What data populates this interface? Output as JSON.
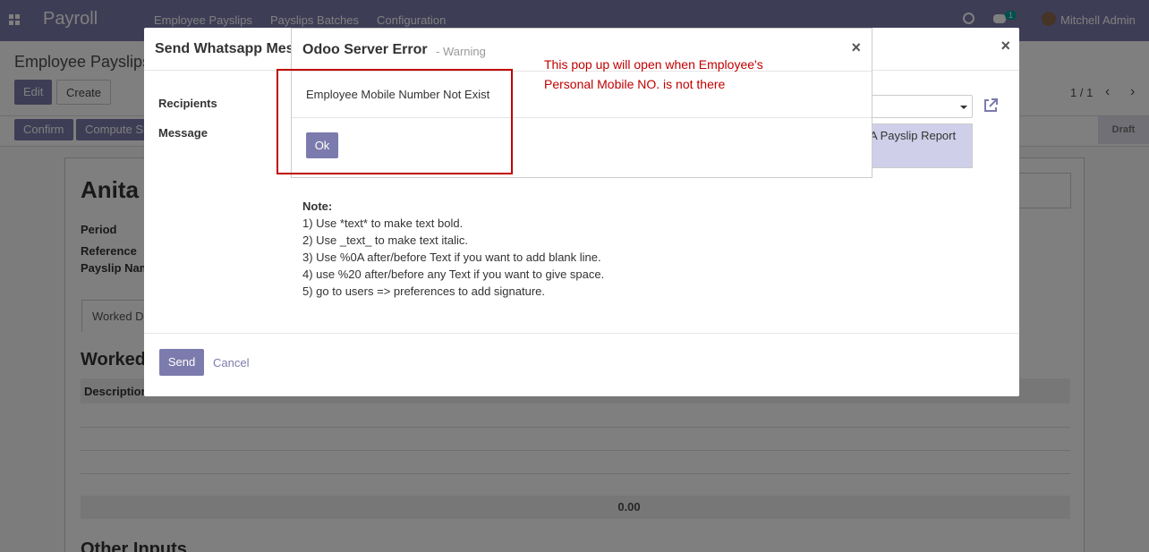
{
  "navbar": {
    "brand": "Payroll",
    "menu": [
      "Employee Payslips",
      "Payslips Batches",
      "Configuration"
    ],
    "chat_badge": "1",
    "user": "Mitchell Admin"
  },
  "control_panel": {
    "breadcrumb": "Employee Payslips",
    "edit_label": "Edit",
    "create_label": "Create",
    "pager": "1 / 1"
  },
  "statusbar": {
    "confirm_label": "Confirm",
    "compute_label": "Compute Sheet",
    "status": "Draft"
  },
  "sheet": {
    "employee": "Anita",
    "period_label": "Period",
    "reference_label": "Reference",
    "payslip_name_label": "Payslip Name",
    "tab_worked_days": "Worked Days",
    "section_worked": "Worked Days",
    "col_description": "Description",
    "total": "0.00",
    "section_other": "Other Inputs"
  },
  "wa_dialog": {
    "title": "Send Whatsapp Message",
    "recipients_label": "Recipients",
    "message_label": "Message",
    "message_value": "A Payslip Report",
    "note_title": "Note:",
    "notes": [
      "1) Use *text* to make text bold.",
      "2) Use _text_ to make text italic.",
      "3) Use %0A after/before Text if you want to add blank line.",
      "4) use %20 after/before any Text if you want to give space.",
      "5) go to users => preferences to add signature."
    ],
    "send_label": "Send",
    "cancel_label": "Cancel"
  },
  "error_dialog": {
    "title": "Odoo Server Error",
    "subtitle": "- Warning",
    "message": "Employee Mobile Number Not Exist",
    "ok_label": "Ok"
  },
  "annotation": {
    "line1": "This pop up will open when Employee's",
    "line2": "Personal Mobile NO. is not there"
  },
  "colors": {
    "primary": "#7c7bad",
    "annotation": "#c00000"
  }
}
